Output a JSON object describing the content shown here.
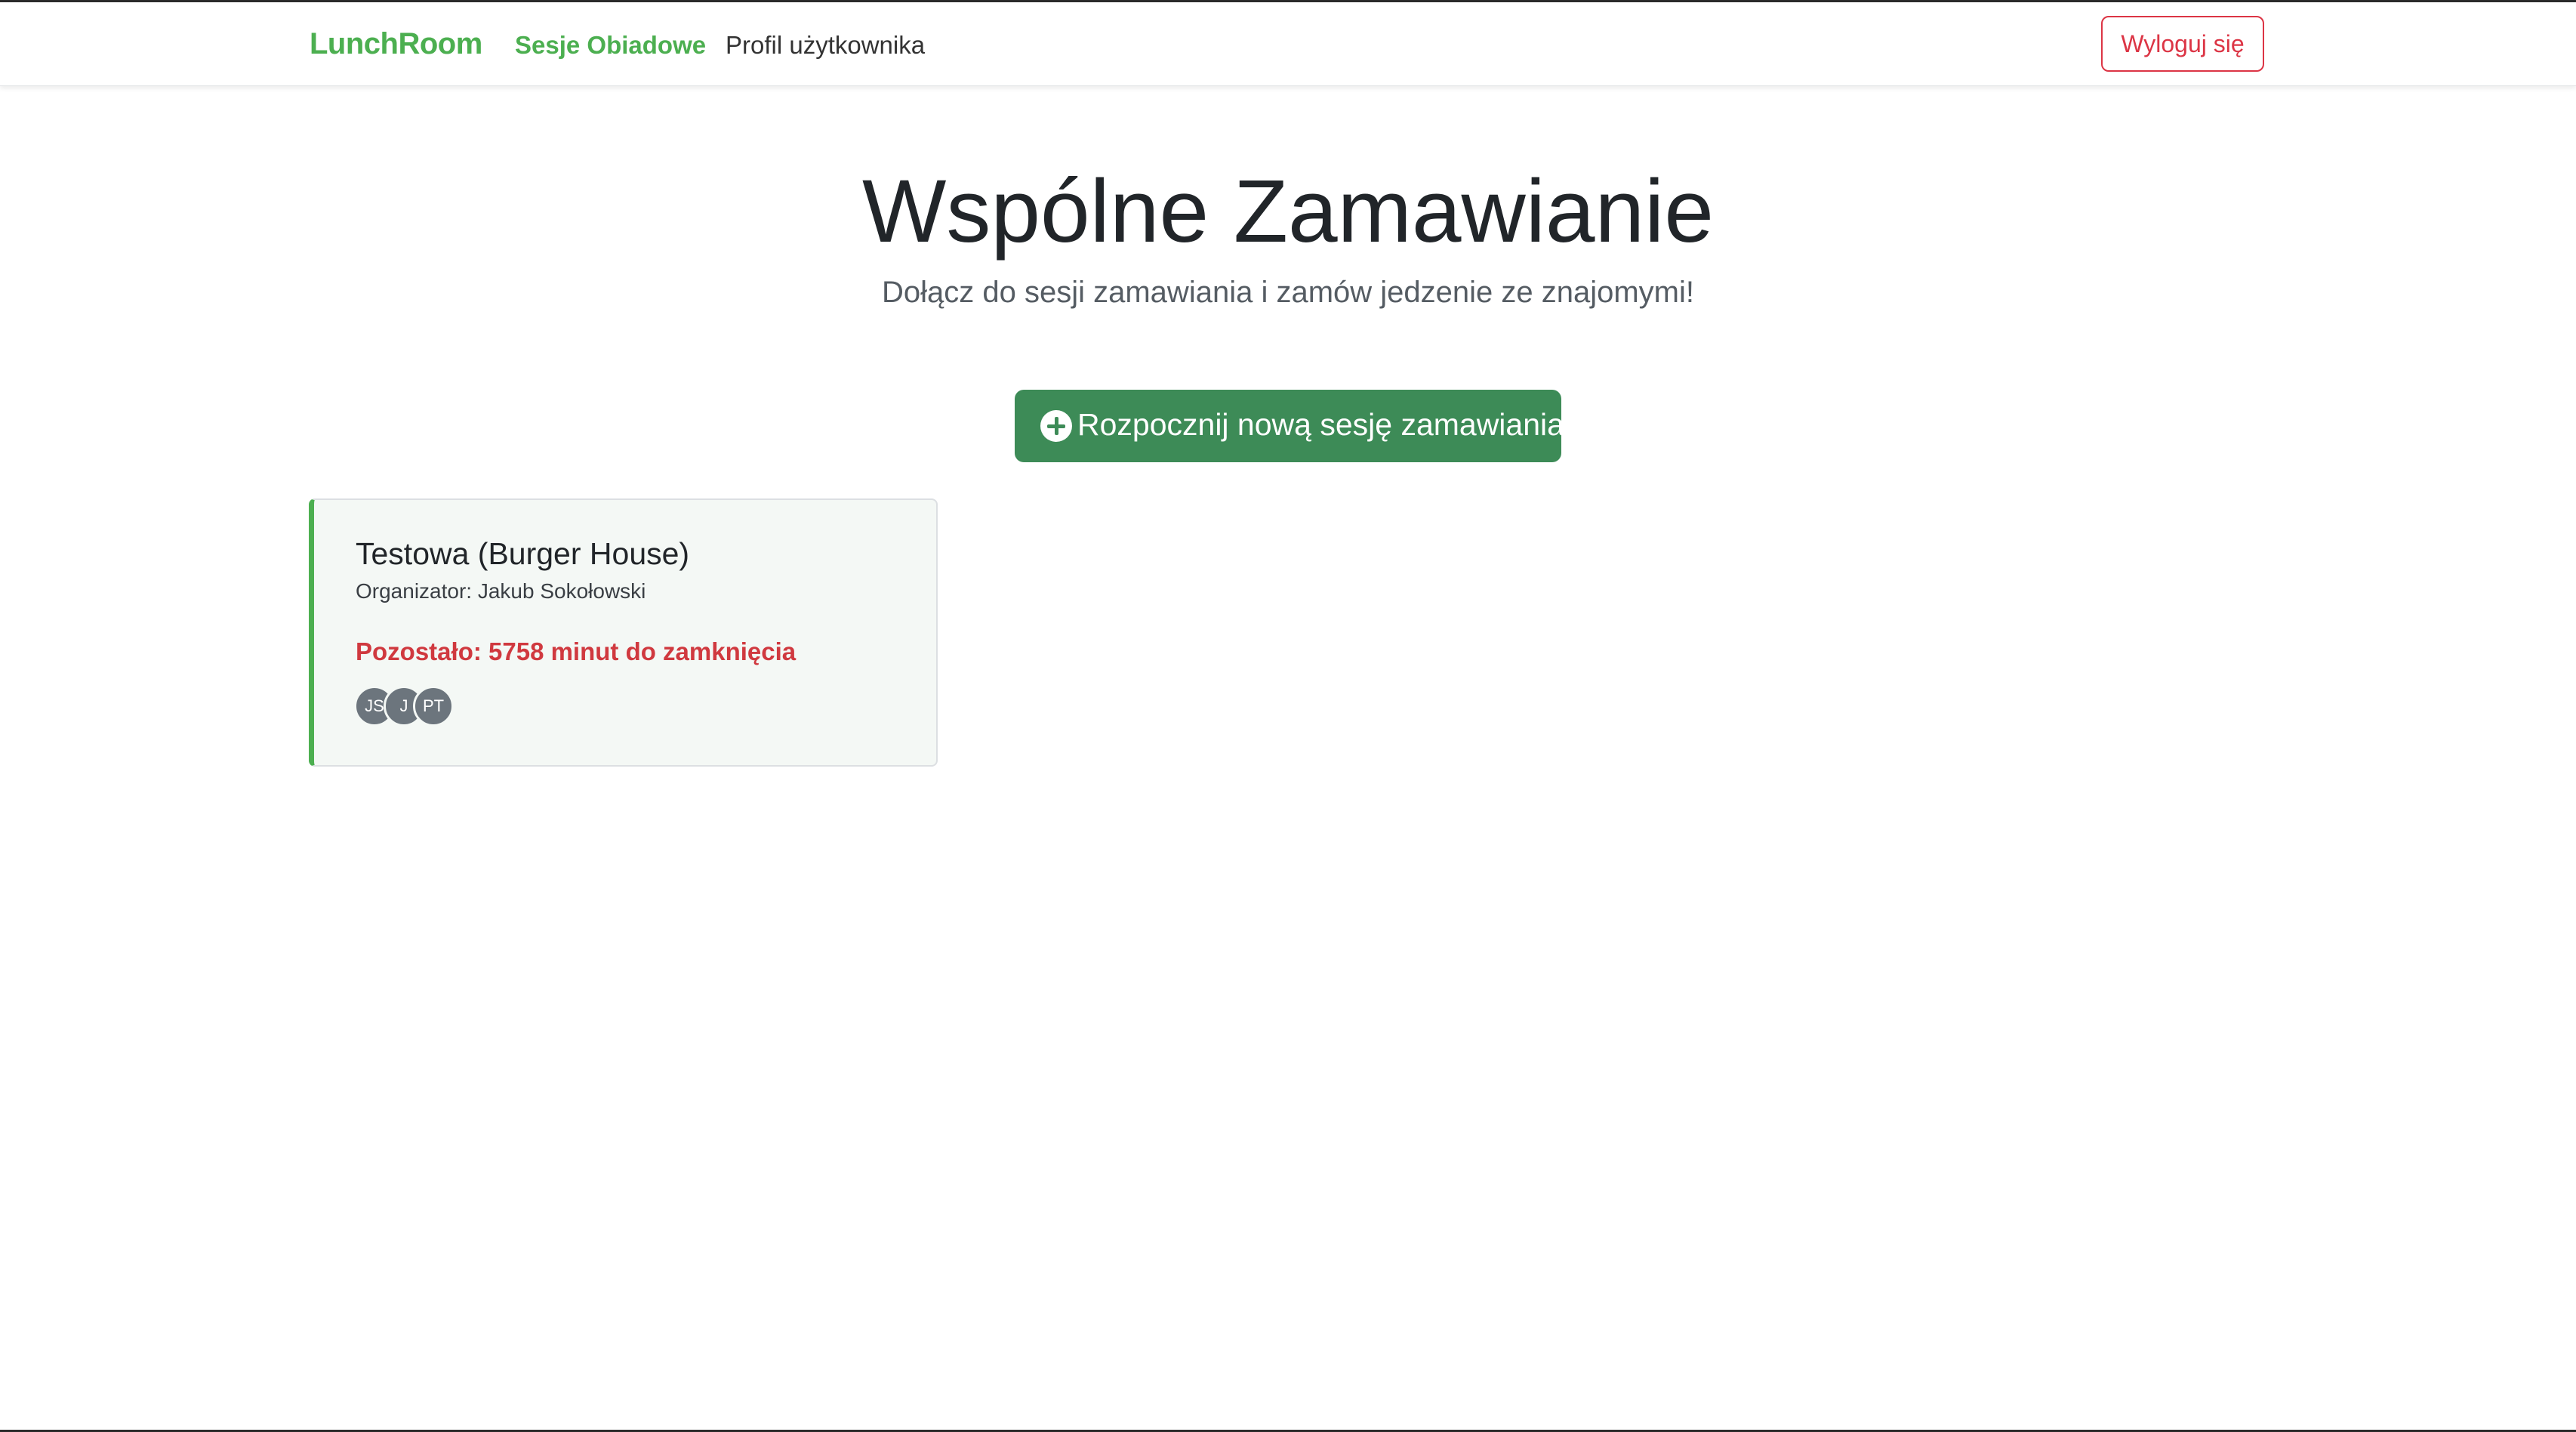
{
  "navbar": {
    "brand": "LunchRoom",
    "links": [
      {
        "label": "Sesje Obiadowe",
        "active": true
      },
      {
        "label": "Profil użytkownika",
        "active": false
      }
    ],
    "logout_label": "Wyloguj się"
  },
  "hero": {
    "title": "Wspólne Zamawianie",
    "subtitle": "Dołącz do sesji zamawiania i zamów jedzenie ze znajomymi!",
    "start_button_label": "Rozpocznij nową sesję zamawiania",
    "start_button_icon": "plus-circle-icon"
  },
  "sessions": [
    {
      "title": "Testowa (Burger House)",
      "organizer": "Organizator: Jakub Sokołowski",
      "remaining": "Pozostało: 5758 minut do zamknięcia",
      "participants": [
        "JS",
        "J",
        "PT"
      ]
    }
  ],
  "colors": {
    "brand": "#4caf50",
    "primary_button": "#3d8b57",
    "danger": "#dc3545",
    "card_background": "#f4f8f5",
    "avatar": "#6c757d"
  }
}
